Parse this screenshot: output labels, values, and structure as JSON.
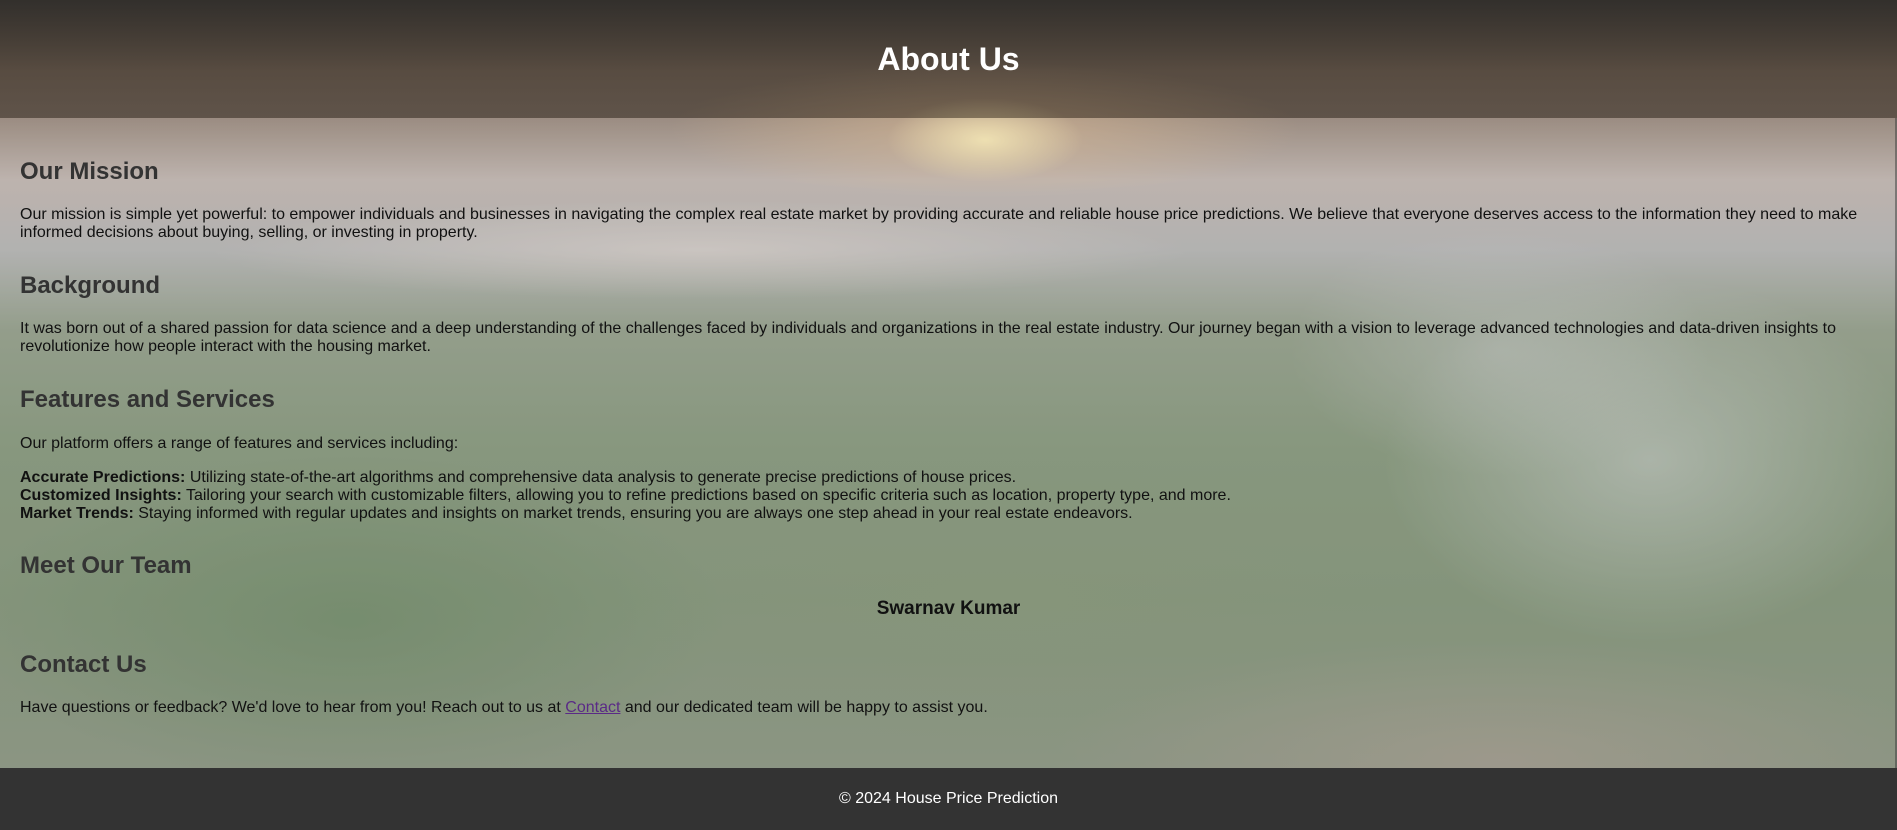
{
  "header": {
    "title": "About Us"
  },
  "mission": {
    "heading": "Our Mission",
    "text": "Our mission is simple yet powerful: to empower individuals and businesses in navigating the complex real estate market by providing accurate and reliable house price predictions. We believe that everyone deserves access to the information they need to make informed decisions about buying, selling, or investing in property."
  },
  "background": {
    "heading": "Background",
    "text": "It was born out of a shared passion for data science and a deep understanding of the challenges faced by individuals and organizations in the real estate industry. Our journey began with a vision to leverage advanced technologies and data-driven insights to revolutionize how people interact with the housing market."
  },
  "features": {
    "heading": "Features and Services",
    "intro": "Our platform offers a range of features and services including:",
    "items": [
      {
        "title": "Accurate Predictions:",
        "text": " Utilizing state-of-the-art algorithms and comprehensive data analysis to generate precise predictions of house prices."
      },
      {
        "title": "Customized Insights:",
        "text": " Tailoring your search with customizable filters, allowing you to refine predictions based on specific criteria such as location, property type, and more."
      },
      {
        "title": "Market Trends:",
        "text": " Staying informed with regular updates and insights on market trends, ensuring you are always one step ahead in your real estate endeavors."
      }
    ]
  },
  "team": {
    "heading": "Meet Our Team",
    "member": "Swarnav Kumar"
  },
  "contact": {
    "heading": "Contact Us",
    "text_before": "Have questions or feedback? We'd love to hear from you! Reach out to us at ",
    "link_label": "Contact",
    "text_after": " and our dedicated team will be happy to assist you."
  },
  "footer": {
    "text": "© 2024 House Price Prediction"
  },
  "colors": {
    "header_bg": "#333333",
    "footer_bg": "#333333",
    "heading": "#333333",
    "link": "#5a2a86"
  }
}
